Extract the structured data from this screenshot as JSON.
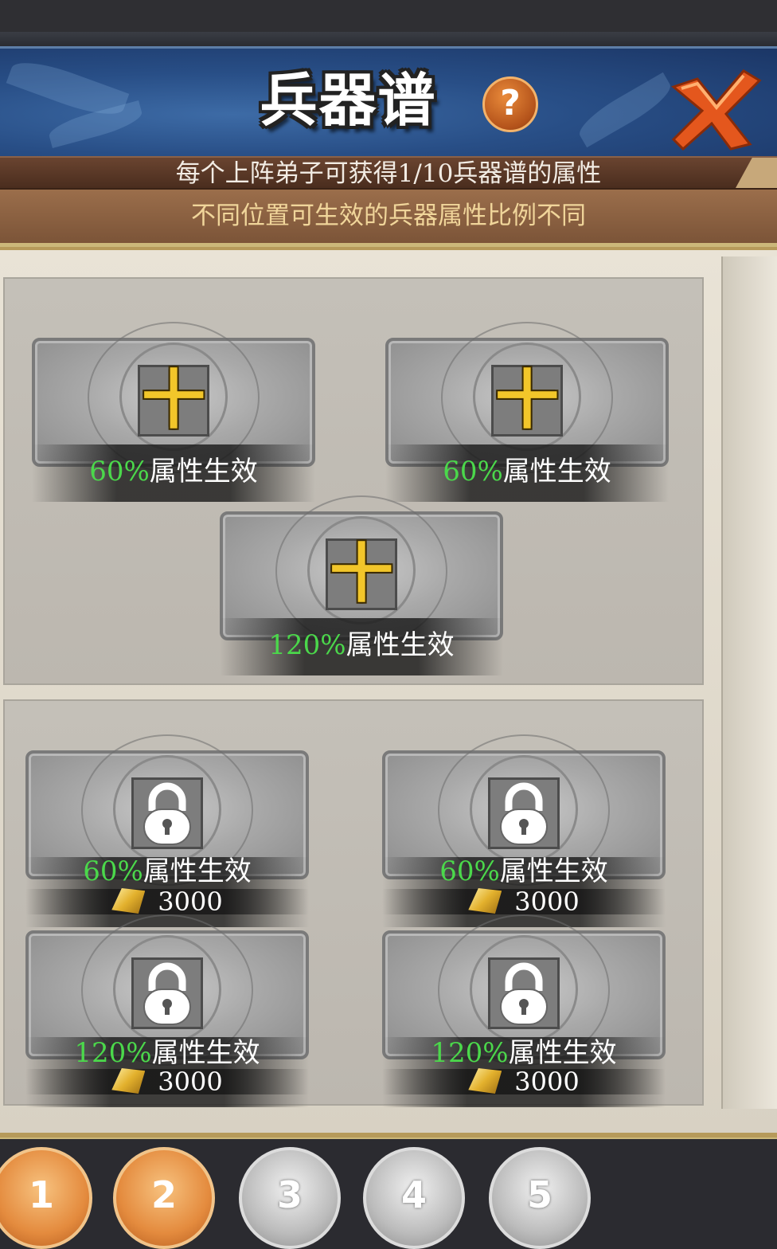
{
  "header": {
    "title": "兵器谱",
    "help_icon": "question-icon",
    "help_text": "?",
    "close_icon": "close-x-icon"
  },
  "info": {
    "line1": "每个上阵弟子可获得1/10兵器谱的属性",
    "line2": "不同位置可生效的兵器属性比例不同"
  },
  "colors": {
    "header_blue": "#284e86",
    "percent_green": "#4bd84b",
    "info_yellow": "#f0d59a",
    "tab_active": "#e48b3e"
  },
  "active_slots": [
    {
      "percent": "60%",
      "suffix": "属性生效",
      "icon": "plus-icon",
      "symbol": "十"
    },
    {
      "percent": "60%",
      "suffix": "属性生效",
      "icon": "plus-icon",
      "symbol": "十"
    },
    {
      "percent": "120%",
      "suffix": "属性生效",
      "icon": "plus-icon",
      "symbol": "十"
    }
  ],
  "locked_slots": [
    {
      "percent": "60%",
      "suffix": "属性生效",
      "icon": "lock-icon",
      "cost": "3000",
      "cost_icon": "gold-ingot-icon"
    },
    {
      "percent": "60%",
      "suffix": "属性生效",
      "icon": "lock-icon",
      "cost": "3000",
      "cost_icon": "gold-ingot-icon"
    },
    {
      "percent": "120%",
      "suffix": "属性生效",
      "icon": "lock-icon",
      "cost": "3000",
      "cost_icon": "gold-ingot-icon"
    },
    {
      "percent": "120%",
      "suffix": "属性生效",
      "icon": "lock-icon",
      "cost": "3000",
      "cost_icon": "gold-ingot-icon"
    }
  ],
  "tabs": [
    {
      "label": "1",
      "state": "active"
    },
    {
      "label": "2",
      "state": "active"
    },
    {
      "label": "3",
      "state": "inactive"
    },
    {
      "label": "4",
      "state": "inactive"
    },
    {
      "label": "5",
      "state": "inactive"
    }
  ]
}
